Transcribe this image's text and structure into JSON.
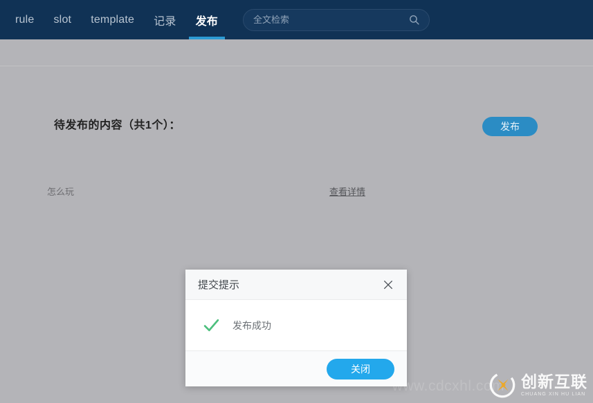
{
  "navbar": {
    "tabs": [
      {
        "label": "rule",
        "active": false
      },
      {
        "label": "slot",
        "active": false
      },
      {
        "label": "template",
        "active": false
      },
      {
        "label": "记录",
        "active": false
      },
      {
        "label": "发布",
        "active": true
      }
    ],
    "search": {
      "placeholder": "全文检索",
      "value": "",
      "icon": "search-icon"
    },
    "background_color": "#103255",
    "active_underline_color": "#2d9bd4"
  },
  "main": {
    "section_heading": "待发布的内容（共1个）：",
    "publish_button": "发布",
    "publish_button_color": "#2b8cc4",
    "items": [
      {
        "title": "怎么玩",
        "link_label": "查看详情"
      }
    ]
  },
  "modal": {
    "title": "提交提示",
    "close_icon": "close-icon",
    "status_icon": "check-icon",
    "status_icon_color": "#4cbf7d",
    "message": "发布成功",
    "footer_button": "关闭",
    "footer_button_color": "#23a8ec"
  },
  "watermark": {
    "cn": "创新互联",
    "en": "CHUANG XIN HU LIAN",
    "faint_text": "www.cdcxhl.com"
  }
}
